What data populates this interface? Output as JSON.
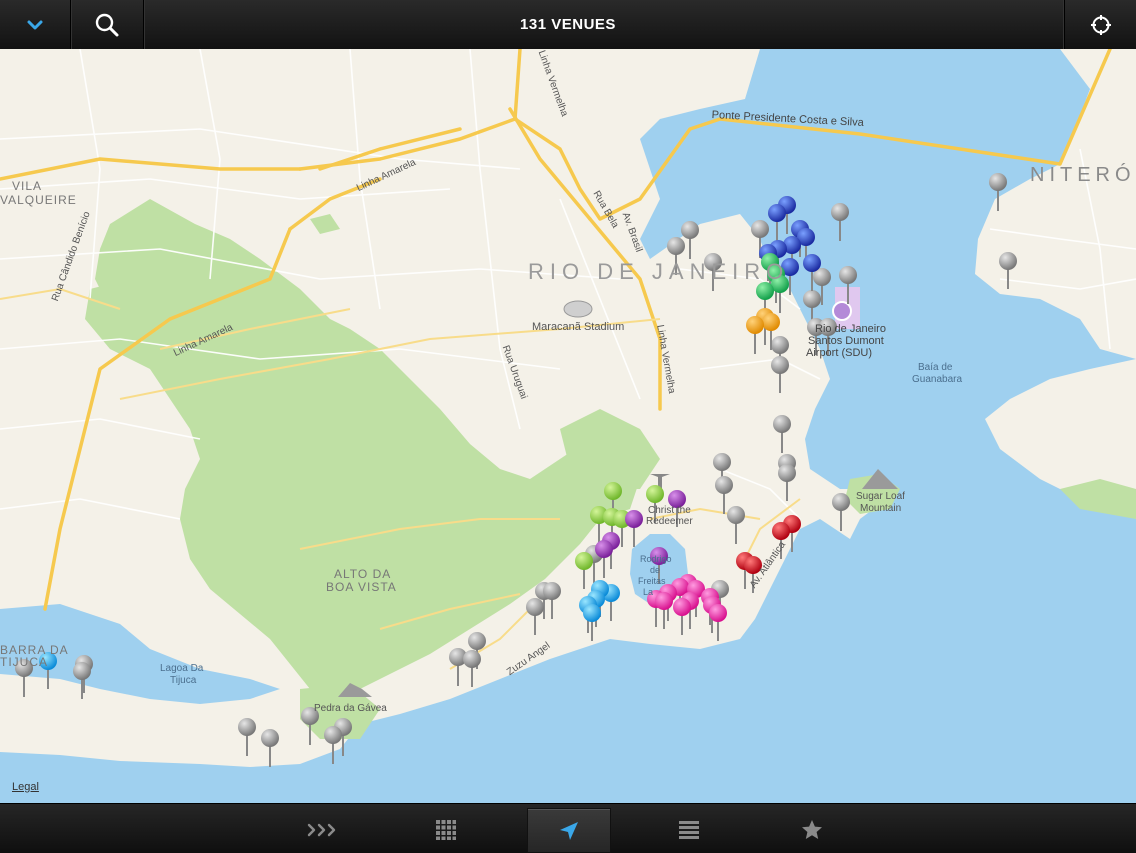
{
  "header": {
    "title": "131 VENUES"
  },
  "icons": {
    "collapse": "chevron-down-icon",
    "search": "search-icon",
    "locate": "crosshair-icon"
  },
  "colors": {
    "accent": "#3aa7e8",
    "water": "#9fd0ef",
    "land": "#f4f1e8",
    "park": "#bfe0a4"
  },
  "map": {
    "legal": "Legal",
    "labels": {
      "niteroi": "NITERÓ",
      "rio": "RIO DE JANEIRO",
      "vila": "VILA",
      "valqueire": "VALQUEIRE",
      "ponte": "Ponte Presidente Costa e Silva",
      "linha_amarela_1": "Linha Amarela",
      "linha_amarela_2": "Linha Amarela",
      "linha_vermelha_1": "Linha Vermelha",
      "linha_vermelha_2": "Linha Vermelha",
      "rua_candido": "Rua Cândido Benício",
      "av_brasil": "Av. Brasil",
      "rua_bela": "Rua Bela",
      "maracana": "Maracanã Stadium",
      "rua_uruguai": "Rua Uruguai",
      "sdu_1": "Rio de Janeiro",
      "sdu_2": "Santos Dumont",
      "sdu_3": "Airport (SDU)",
      "baia_1": "Baía de",
      "baia_2": "Guanabara",
      "sugar_1": "Sugar Loaf",
      "sugar_2": "Mountain",
      "christ_1": "Christ the",
      "christ_2": "Redeemer",
      "lagoa_1": "Rodrigo",
      "lagoa_2": "de",
      "lagoa_3": "Freitas",
      "lagoa_4": "La",
      "av_atlantica": "Av. Atlântica",
      "alto_1": "ALTO DA",
      "alto_2": "BOA VISTA",
      "zuzu": "Zuzu Angel",
      "lagoa_tijuca_1": "Lagoa Da",
      "lagoa_tijuca_2": "Tijuca",
      "gavea": "Pedra da Gávea",
      "barra_1": "BARRA DA",
      "barra_2": "TIJUCA"
    }
  },
  "tabs": [
    {
      "name": "tab-featured",
      "icon": "triple-chevron-icon",
      "active": false
    },
    {
      "name": "tab-grid",
      "icon": "grid-icon",
      "active": false
    },
    {
      "name": "tab-map",
      "icon": "location-arrow-icon",
      "active": true
    },
    {
      "name": "tab-list",
      "icon": "list-icon",
      "active": false
    },
    {
      "name": "tab-favorites",
      "icon": "star-icon",
      "active": false
    }
  ]
}
